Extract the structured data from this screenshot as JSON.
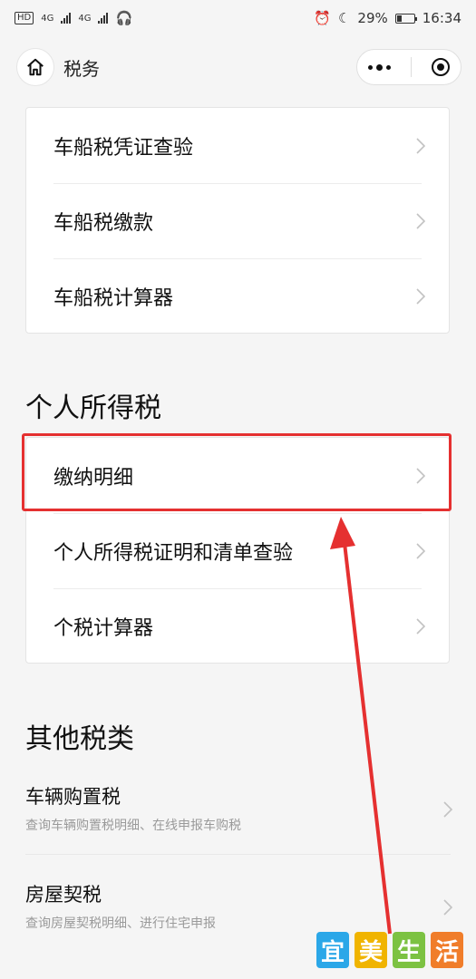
{
  "status_bar": {
    "left_chips": [
      "HD",
      "4G",
      "4G"
    ],
    "battery": "29%",
    "time": "16:34"
  },
  "nav": {
    "title": "税务",
    "home_icon": "home-icon",
    "more_icon": "more-dots-icon",
    "close_icon": "target-close-icon"
  },
  "vehicle_tax": {
    "items": [
      {
        "label": "车船税凭证查验"
      },
      {
        "label": "车船税缴款"
      },
      {
        "label": "车船税计算器"
      }
    ]
  },
  "personal_tax": {
    "title": "个人所得税",
    "items": [
      {
        "label": "缴纳明细"
      },
      {
        "label": "个人所得税证明和清单查验"
      },
      {
        "label": "个税计算器"
      }
    ]
  },
  "other_tax": {
    "title": "其他税类",
    "items": [
      {
        "label": "车辆购置税",
        "desc": "查询车辆购置税明细、在线申报车购税"
      },
      {
        "label": "房屋契税",
        "desc": "查询房屋契税明细、进行住宅申报"
      }
    ]
  },
  "watermark": {
    "chars": [
      "宜",
      "美",
      "生",
      "活"
    ],
    "colors": [
      "#2ba7e8",
      "#f0b400",
      "#7cc242",
      "#f07d2a"
    ]
  },
  "colors": {
    "highlight": "#e53030"
  },
  "battery_level": 0.29
}
